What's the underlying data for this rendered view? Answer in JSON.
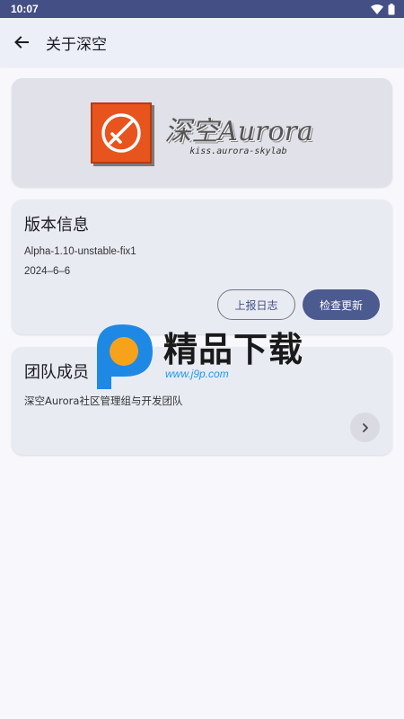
{
  "status_bar": {
    "time": "10:07"
  },
  "app_bar": {
    "title": "关于深空",
    "back_icon": "arrow-left-icon"
  },
  "banner": {
    "logo_title": "深空Aurora",
    "logo_subtitle": "kiss.aurora-skylab"
  },
  "version_card": {
    "title": "版本信息",
    "version": "Alpha-1.10-unstable-fix1",
    "date": "2024–6–6",
    "report_log_label": "上报日志",
    "check_update_label": "检查更新"
  },
  "team_card": {
    "title": "团队成员",
    "description": "深空Aurora社区管理组与开发团队",
    "chevron_icon": "chevron-right-icon"
  },
  "watermark": {
    "title": "精品下载",
    "url": "www.j9p.com"
  },
  "colors": {
    "status_bar": "#434f85",
    "primary_button": "#4b5a8f",
    "card_bg": "#e9ebf3",
    "logo_orange": "#e8541e",
    "watermark_blue": "#1e88e5",
    "watermark_orange": "#f7a21b"
  }
}
